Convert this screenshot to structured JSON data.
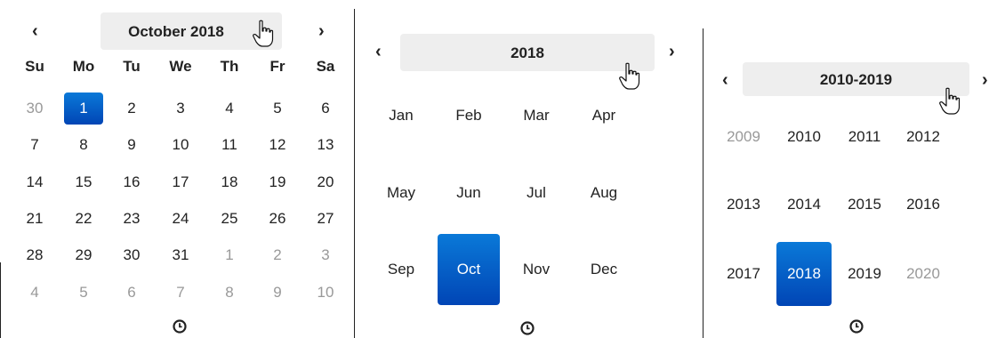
{
  "days_view": {
    "title": "October 2018",
    "prev_label": "‹",
    "next_label": "›",
    "weekdays": [
      "Su",
      "Mo",
      "Tu",
      "We",
      "Th",
      "Fr",
      "Sa"
    ],
    "weeks": [
      [
        "30",
        "1",
        "2",
        "3",
        "4",
        "5",
        "6"
      ],
      [
        "7",
        "8",
        "9",
        "10",
        "11",
        "12",
        "13"
      ],
      [
        "14",
        "15",
        "16",
        "17",
        "18",
        "19",
        "20"
      ],
      [
        "21",
        "22",
        "23",
        "24",
        "25",
        "26",
        "27"
      ],
      [
        "28",
        "29",
        "30",
        "31",
        "1",
        "2",
        "3"
      ],
      [
        "4",
        "5",
        "6",
        "7",
        "8",
        "9",
        "10"
      ]
    ],
    "selected": "1"
  },
  "months_view": {
    "title": "2018",
    "prev_label": "‹",
    "next_label": "›",
    "months": [
      "Jan",
      "Feb",
      "Mar",
      "Apr",
      "May",
      "Jun",
      "Jul",
      "Aug",
      "Sep",
      "Oct",
      "Nov",
      "Dec"
    ],
    "selected": "Oct"
  },
  "years_view": {
    "title": "2010-2019",
    "prev_label": "‹",
    "next_label": "›",
    "years": [
      "2009",
      "2010",
      "2011",
      "2012",
      "2013",
      "2014",
      "2015",
      "2016",
      "2017",
      "2018",
      "2019",
      "2020"
    ],
    "selected": "2018"
  },
  "icons": {
    "time_toggle": "clock-icon",
    "pointer": "hand-cursor-icon"
  },
  "colors": {
    "selected_top": "#0a79d8",
    "selected_bottom": "#0145b5",
    "muted": "#999999",
    "hover": "#eeeeee"
  }
}
